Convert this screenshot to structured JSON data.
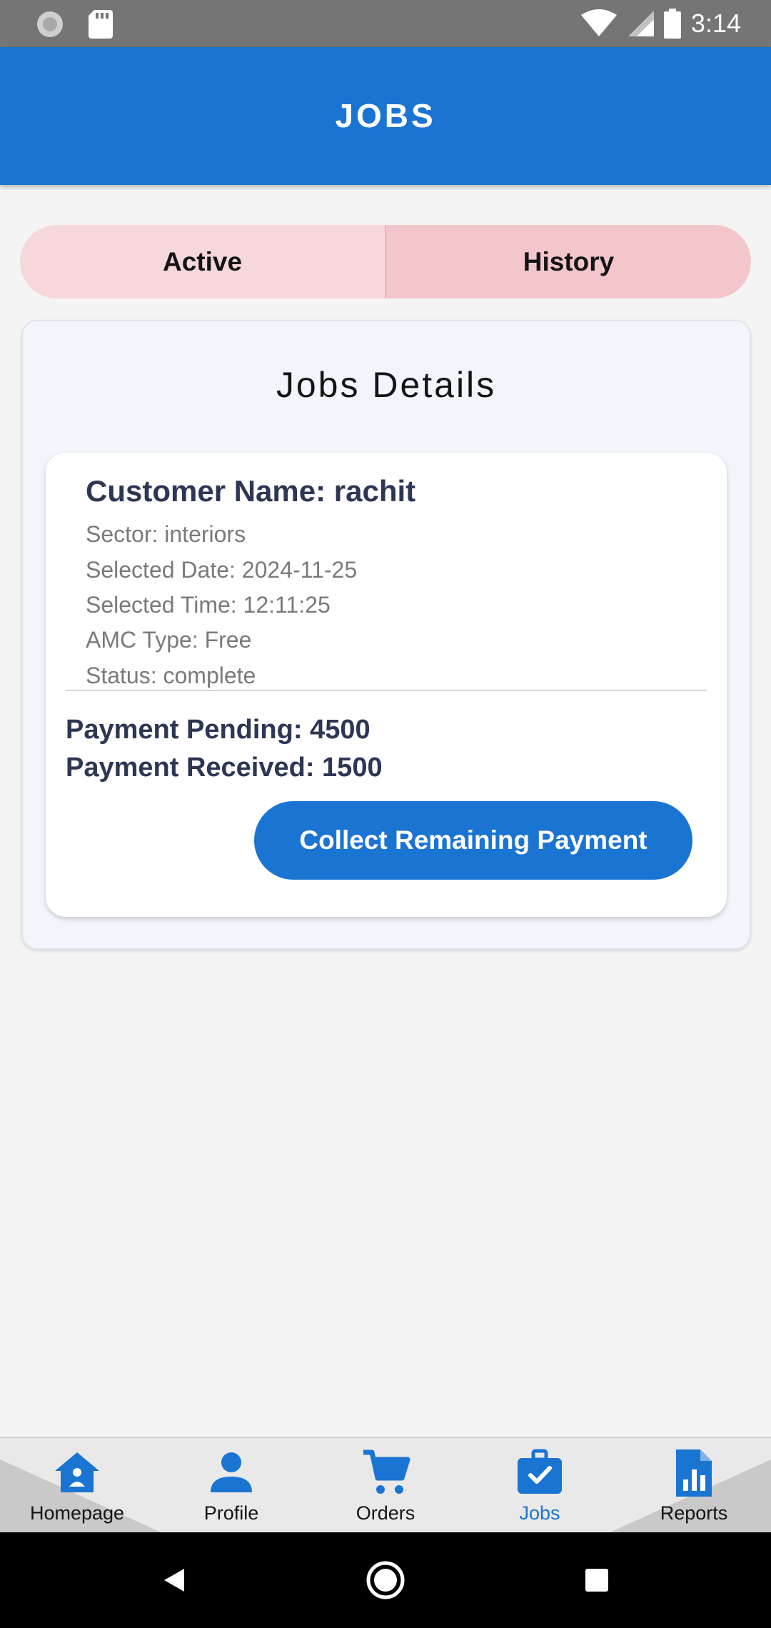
{
  "status_bar": {
    "time": "3:14"
  },
  "app_bar": {
    "title": "JOBS"
  },
  "tabs": [
    {
      "label": "Active"
    },
    {
      "label": "History"
    }
  ],
  "jobs_section": {
    "heading": "Jobs Details",
    "job": {
      "customer": "Customer Name: rachit",
      "sector": "Sector: interiors",
      "date": "Selected Date: 2024-11-25",
      "time": "Selected Time: 12:11:25",
      "amc": "AMC Type: Free",
      "status": "Status: complete",
      "payment_pending": "Payment Pending: 4500",
      "payment_received": "Payment Received: 1500",
      "collect_button": "Collect Remaining Payment"
    }
  },
  "bottom_nav": {
    "items": [
      {
        "label": "Homepage",
        "icon": "home-icon"
      },
      {
        "label": "Profile",
        "icon": "person-icon"
      },
      {
        "label": "Orders",
        "icon": "cart-icon"
      },
      {
        "label": "Jobs",
        "icon": "briefcase-check-icon",
        "active": true
      },
      {
        "label": "Reports",
        "icon": "report-chart-icon"
      }
    ]
  },
  "colors": {
    "primary": "#1a74d2",
    "tab_active_bg": "#f6d7da",
    "tab_history_bg": "#f3c6cc",
    "text_dark": "#2d3654"
  }
}
